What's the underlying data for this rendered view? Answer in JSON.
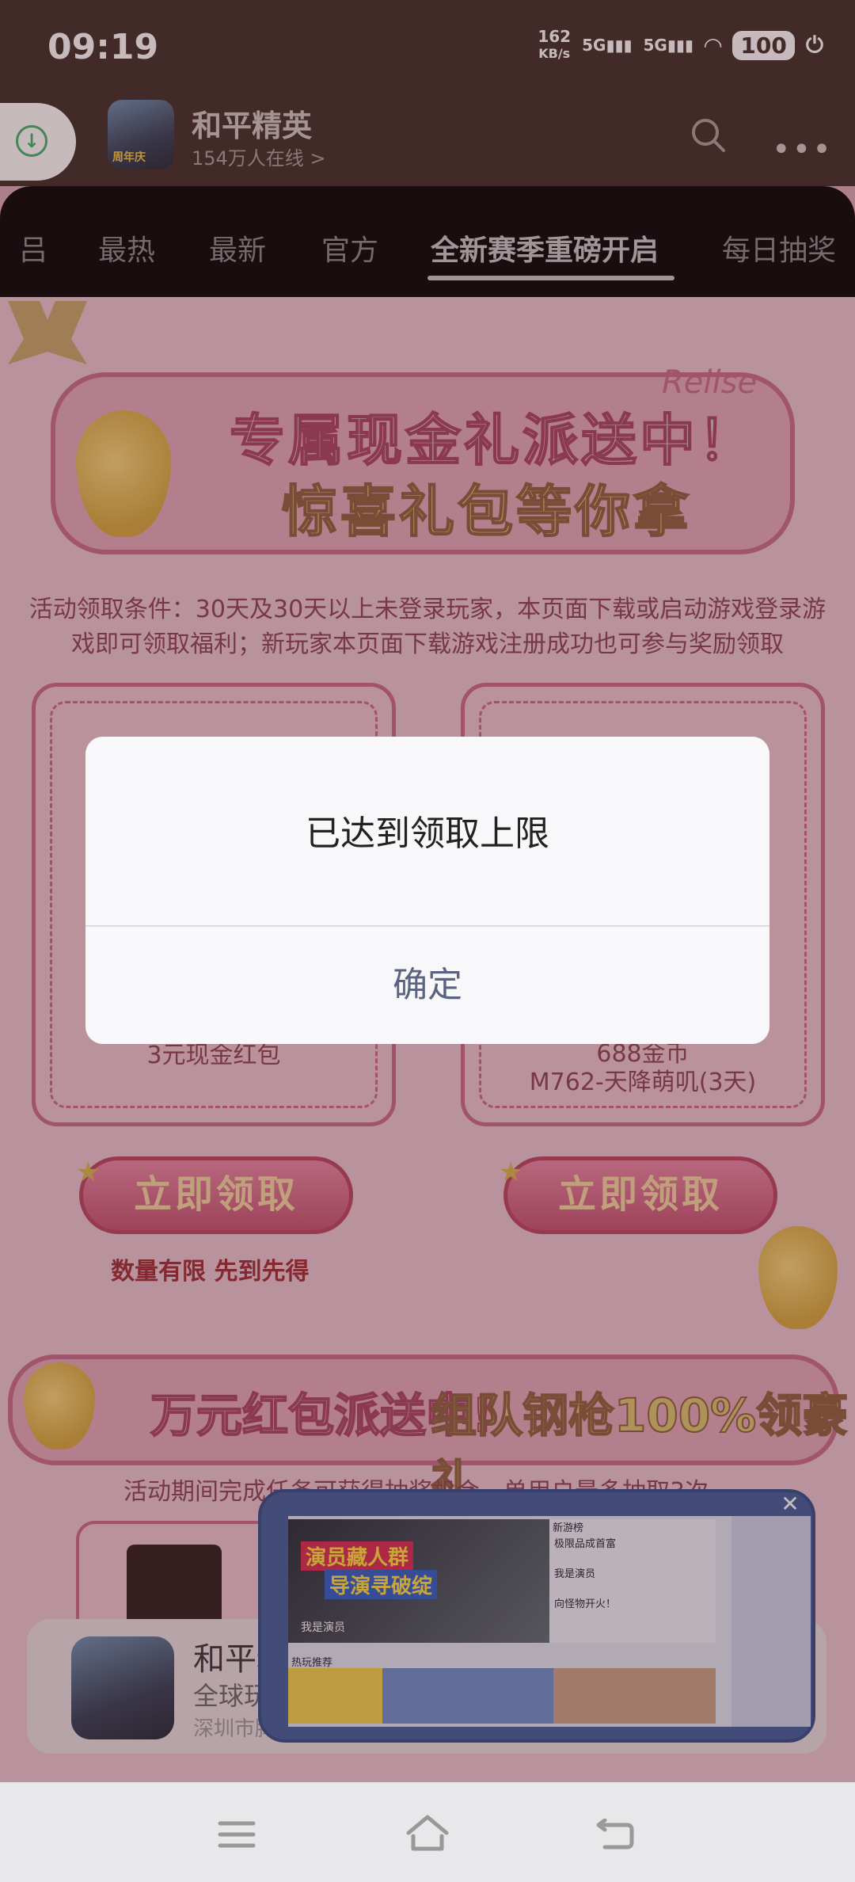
{
  "status": {
    "time": "09:19",
    "net_speed": "162",
    "net_unit": "KB/s",
    "sig1": "5G",
    "sig2": "5G",
    "battery": "100"
  },
  "header": {
    "title": "和平精英",
    "online": "154万人在线 >"
  },
  "tabs": {
    "items": [
      "吕",
      "最热",
      "最新",
      "官方",
      "全新赛季重磅开启",
      "每日抽奖"
    ]
  },
  "banner1": {
    "line1": "专属现金礼派送中！",
    "line2": "惊喜礼包等你拿",
    "script": "Relise"
  },
  "conditions": "活动领取条件：30天及30天以上未登录玩家，本页面下载或启动游戏登录游戏即可领取福利；新玩家本页面下载游戏注册成功也可参与奖励领取",
  "cards": {
    "left": {
      "reward": "3元现金红包",
      "button": "立即领取"
    },
    "right": {
      "reward_line1": "688金币",
      "reward_line2": "M762-天降萌叽(3天)",
      "button": "立即领取"
    }
  },
  "limit_text": "数量有限 先到先得",
  "banner2": {
    "part1": "万元红包派送中!",
    "part2": "组队钢枪100%领豪礼"
  },
  "activity_text": "活动期间完成任务可获得抽奖机会，单用户最多抽取3次",
  "bottom_card": {
    "title": "和平精英",
    "subtitle": "全球玩",
    "location": "深圳市腾"
  },
  "mini_window": {
    "hero_title1": "演员藏人群",
    "hero_title2": "导演寻破绽",
    "new_list_title": "新游榜",
    "rows": [
      "极限品成首富",
      "我是演员",
      "向怪物开火！"
    ],
    "hot_title": "热玩推荐",
    "game_name": "我是演员"
  },
  "dialog": {
    "message": "已达到领取上限",
    "confirm": "确定"
  }
}
